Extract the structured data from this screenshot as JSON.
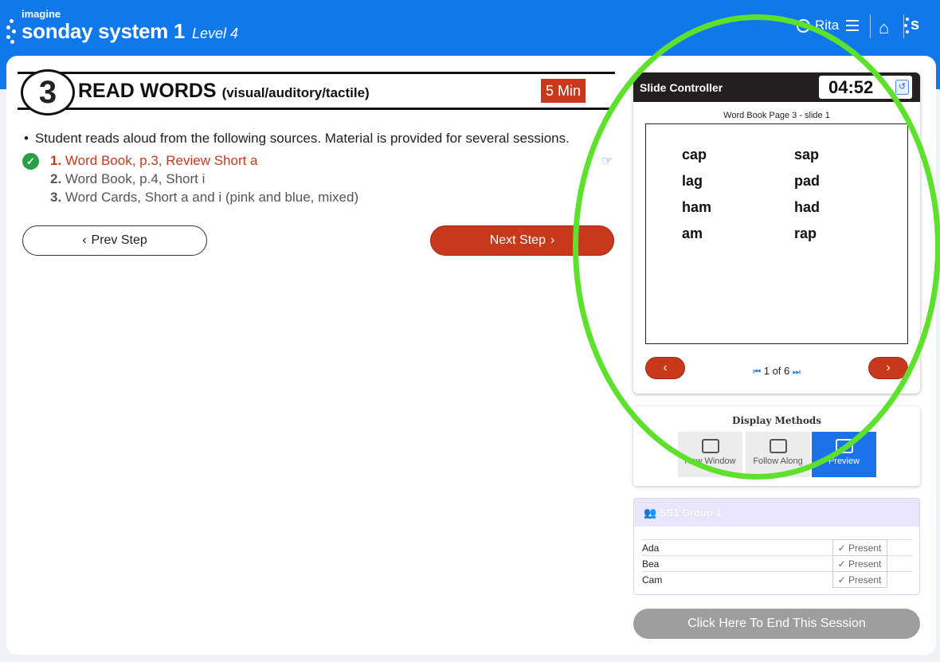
{
  "header": {
    "brand_small": "imagine",
    "brand_name": "sonday system 1",
    "level": "Level 4",
    "user": "Rita",
    "logo_letter": "s",
    "icons": [
      "user-circle-icon",
      "hamburger-menu-icon",
      "home-icon",
      "sonday-logo-icon"
    ]
  },
  "step": {
    "number": "3",
    "title": "READ WORDS",
    "subtitle": "(visual/auditory/tactile)",
    "duration": "5 Min",
    "instruction": "Student reads aloud from the following sources. Material is provided for several sessions.",
    "items": [
      {
        "num": "1.",
        "text": "Word Book, p.3, Review Short a"
      },
      {
        "num": "2.",
        "text": "Word Book, p.4, Short i"
      },
      {
        "num": "3.",
        "text": "Word Cards, Short a and i (pink and blue, mixed)"
      }
    ],
    "prev_label": "Prev Step",
    "next_label": "Next Step"
  },
  "slide_controller": {
    "title": "Slide Controller",
    "timer": "04:52",
    "caption": "Word Book Page 3 - slide 1",
    "words_left": [
      "cap",
      "lag",
      "ham",
      "am"
    ],
    "words_right": [
      "sap",
      "pad",
      "had",
      "rap"
    ],
    "page_current": "1",
    "page_of": "of",
    "page_total": "6"
  },
  "display_methods": {
    "title": "Display Methods",
    "options": [
      "New Window",
      "Follow Along",
      "Preview"
    ],
    "selected": "Preview"
  },
  "group": {
    "name": "SS1 Group 1",
    "students": [
      {
        "name": "Ada",
        "status": "Present"
      },
      {
        "name": "Bea",
        "status": "Present"
      },
      {
        "name": "Cam",
        "status": "Present"
      }
    ]
  },
  "end_session_label": "Click Here To End This Session",
  "colors": {
    "brand_blue": "#1178ec",
    "accent_red": "#c8381b",
    "check_green": "#27a046",
    "highlight_green": "#5ee12c",
    "selected_blue": "#1a73e8"
  }
}
